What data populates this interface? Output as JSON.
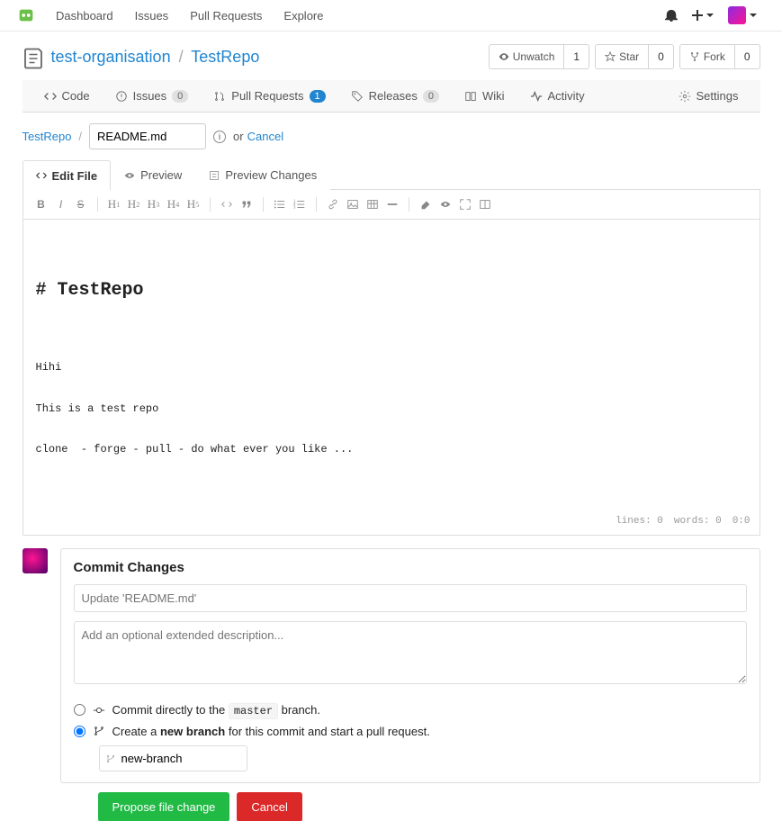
{
  "nav": {
    "links": [
      "Dashboard",
      "Issues",
      "Pull Requests",
      "Explore"
    ]
  },
  "repo": {
    "owner": "test-organisation",
    "name": "TestRepo",
    "actions": {
      "unwatch": "Unwatch",
      "unwatch_count": "1",
      "star": "Star",
      "star_count": "0",
      "fork": "Fork",
      "fork_count": "0"
    },
    "tabs": {
      "code": "Code",
      "issues": "Issues",
      "issues_count": "0",
      "pulls": "Pull Requests",
      "pulls_count": "1",
      "releases": "Releases",
      "releases_count": "0",
      "wiki": "Wiki",
      "activity": "Activity",
      "settings": "Settings"
    }
  },
  "breadcrumb": {
    "root": "TestRepo",
    "filename": "README.md",
    "or": "or",
    "cancel": "Cancel"
  },
  "editTabs": {
    "edit": "Edit File",
    "preview": "Preview",
    "changes": "Preview Changes"
  },
  "editor": {
    "title": "# TestRepo",
    "body": "Hihi\n\nThis is a test repo\n\nclone  - forge - pull - do what ever you like ...",
    "lines": "lines: 0",
    "words": "words: 0",
    "pos": "0:0"
  },
  "commit": {
    "title": "Commit Changes",
    "summary_placeholder": "Update 'README.md'",
    "desc_placeholder": "Add an optional extended description...",
    "direct_prefix": "Commit directly to the ",
    "direct_branch": "master",
    "direct_suffix": " branch.",
    "newbranch_prefix": "Create a ",
    "newbranch_bold": "new branch",
    "newbranch_suffix": " for this commit and start a pull request.",
    "branch_value": "new-branch",
    "propose": "Propose file change",
    "cancel": "Cancel"
  }
}
